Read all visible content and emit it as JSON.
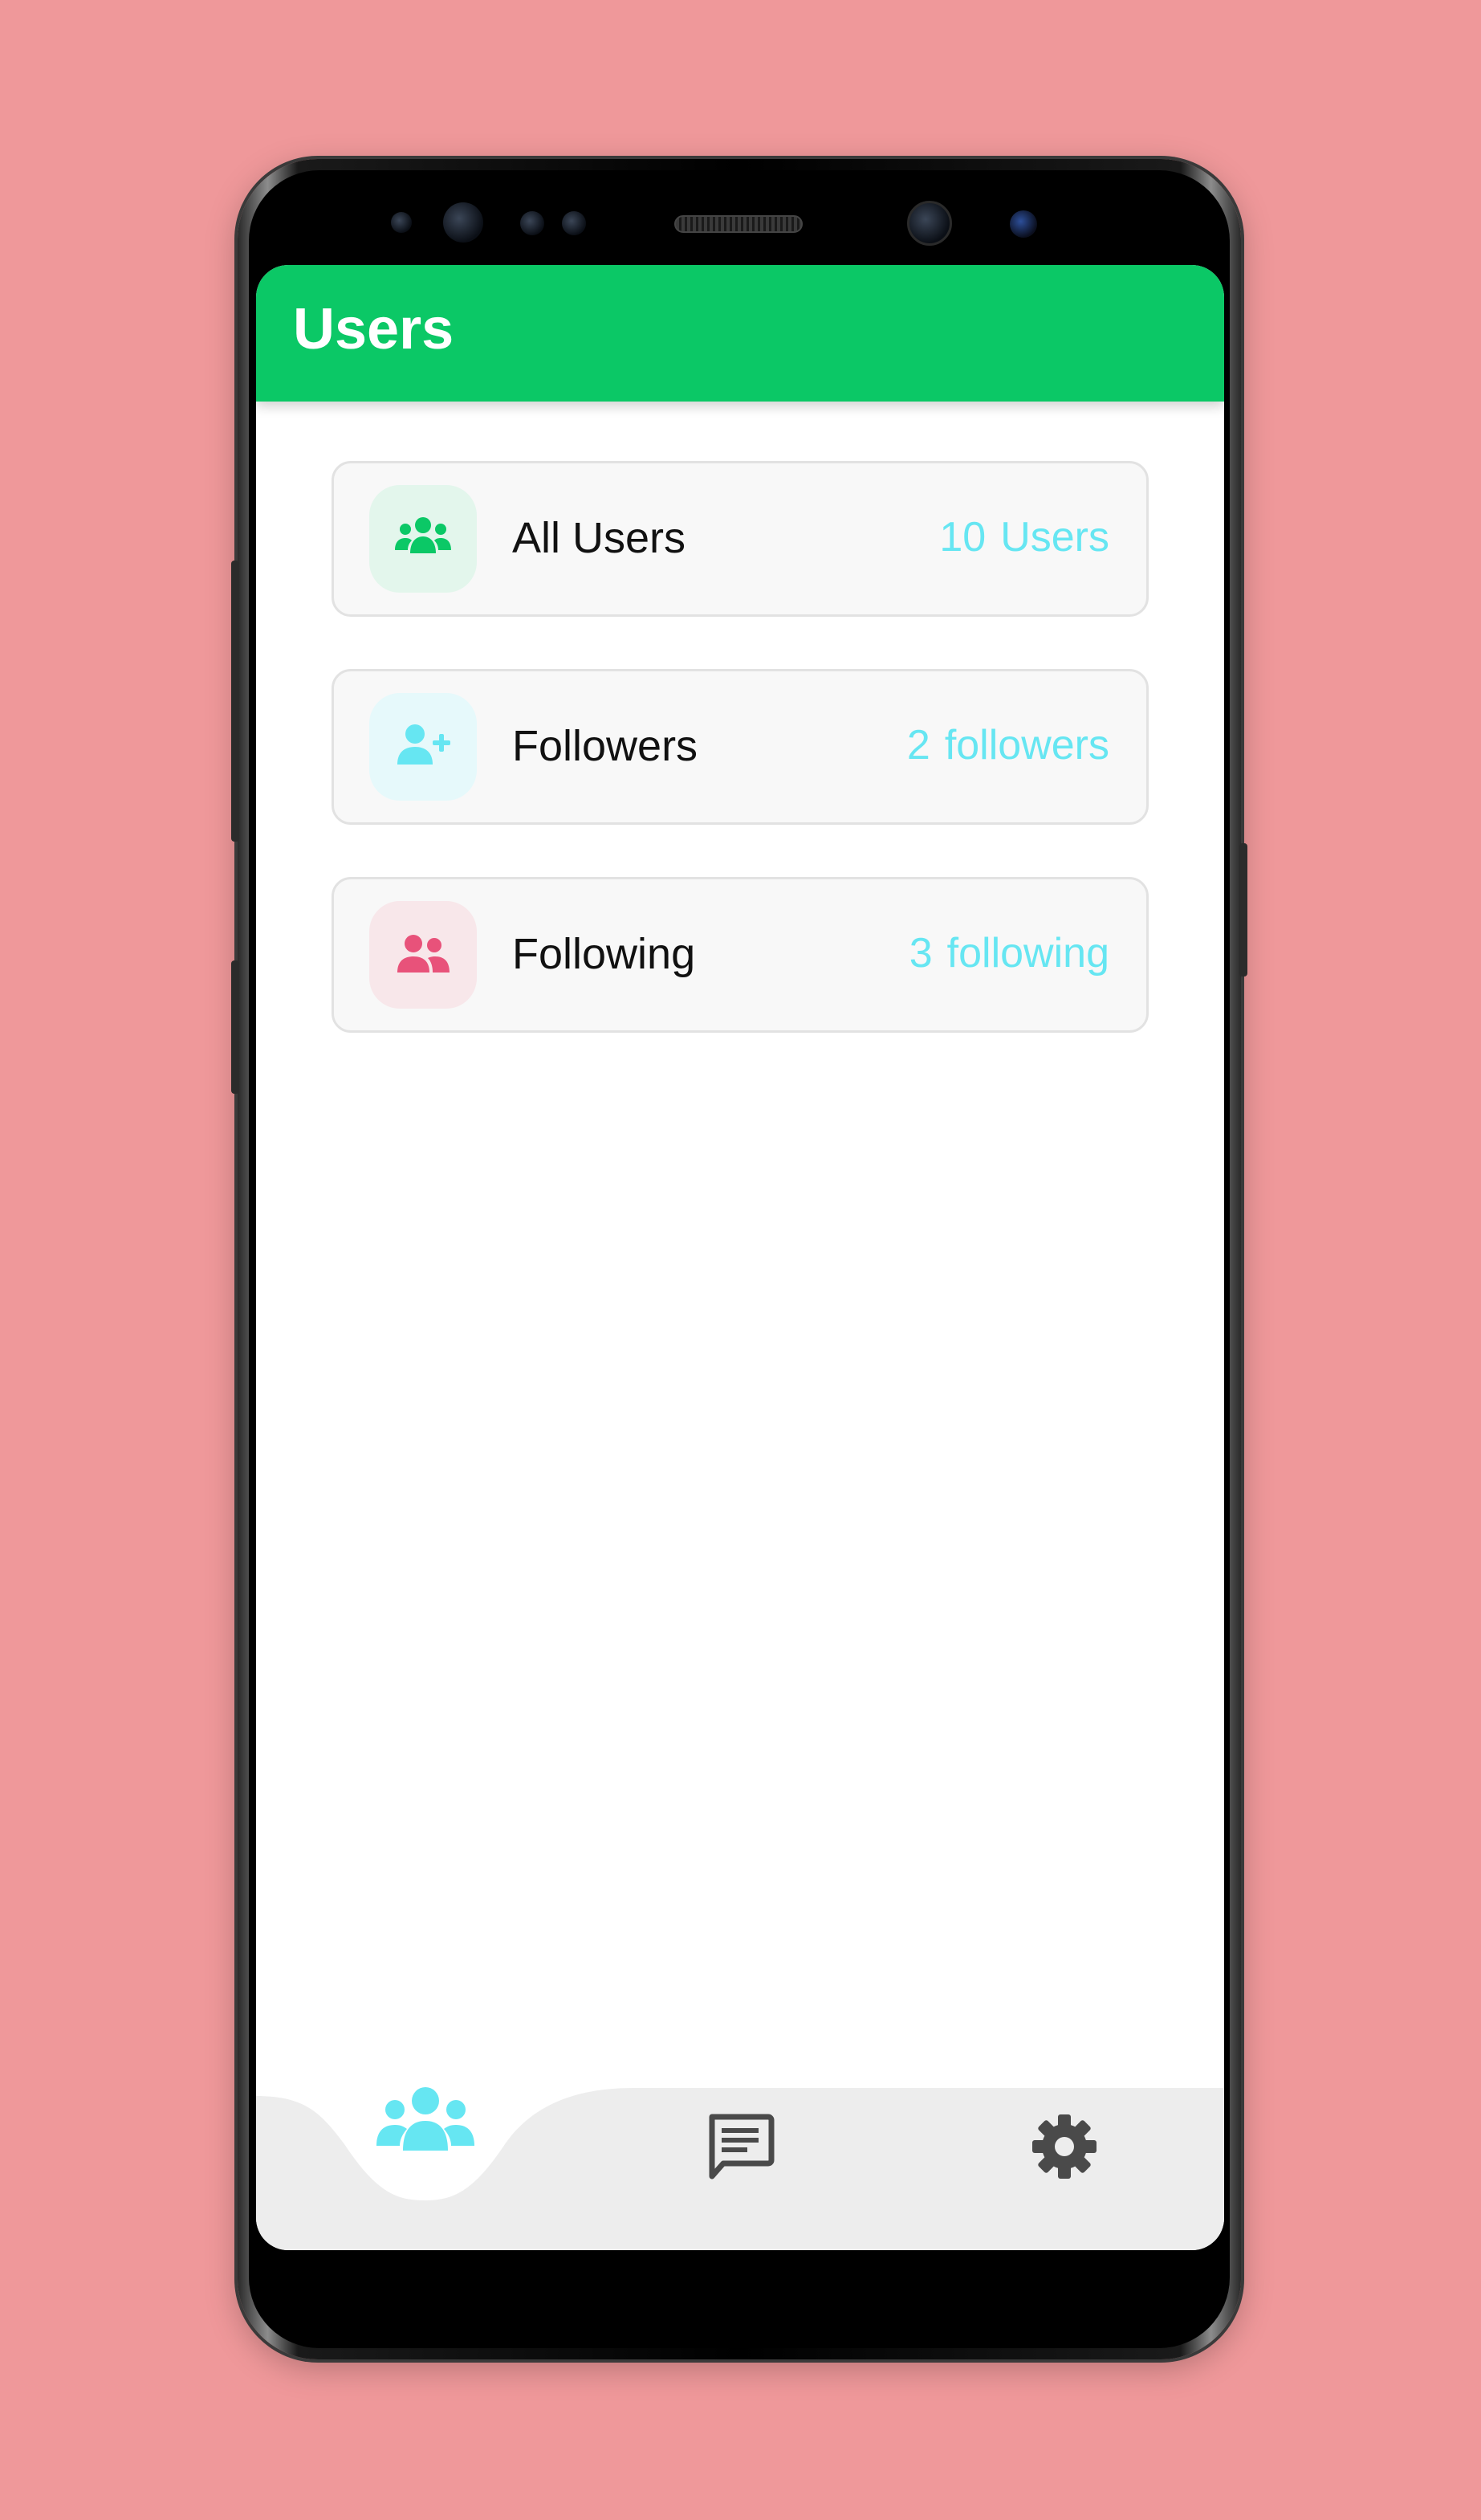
{
  "app_bar": {
    "title": "Users"
  },
  "cards": [
    {
      "label": "All Users",
      "count": "10",
      "unit": "Users",
      "icon": "users-group-icon",
      "accent": "#0bc866",
      "icon_bg": "#e3f6ec"
    },
    {
      "label": "Followers",
      "count": "2",
      "unit": "followers",
      "icon": "user-plus-icon",
      "accent": "#66e6f2",
      "icon_bg": "#e6f9fb"
    },
    {
      "label": "Following",
      "count": "3",
      "unit": "following",
      "icon": "user-friends-icon",
      "accent": "#e8527a",
      "icon_bg": "#f8e7ea"
    }
  ],
  "bottom_nav": {
    "items": [
      {
        "id": "users",
        "icon": "users-group-icon",
        "active": true
      },
      {
        "id": "messages",
        "icon": "message-icon",
        "active": false
      },
      {
        "id": "settings",
        "icon": "gear-icon",
        "active": false
      }
    ],
    "active_color": "#66e6f2",
    "inactive_color": "#4a4a4a",
    "background": "#ededed"
  },
  "colors": {
    "page_background": "#ef989a",
    "primary": "#0bc866",
    "count_text": "#66e6f2"
  }
}
